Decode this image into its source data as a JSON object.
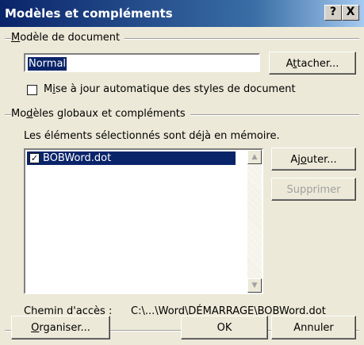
{
  "window": {
    "title": "Modèles et compléments",
    "help_label": "?",
    "close_label": "X"
  },
  "document_template": {
    "group_label": "Modèle de document",
    "value": "Normal",
    "attach_button": "Attacher...",
    "auto_update_label": "Mise à jour automatique des styles de document",
    "auto_update_checked": false
  },
  "global_templates": {
    "group_label": "Modèles globaux et compléments",
    "info_text": "Les éléments sélectionnés sont déjà en mémoire.",
    "items": [
      {
        "label": "BOBWord.dot",
        "checked": true,
        "selected": true
      }
    ],
    "add_button": "Ajouter...",
    "remove_button": "Supprimer",
    "remove_enabled": false,
    "path_label": "Chemin d'accès :",
    "path_value": "C:\\...\\Word\\DÉMARRAGE\\BOBWord.dot"
  },
  "footer": {
    "organize_button": "Organiser...",
    "ok_button": "OK",
    "cancel_button": "Annuler"
  },
  "icons": {
    "scroll_up": "scroll-up-arrow-icon",
    "scroll_down": "scroll-down-arrow-icon",
    "check": "checkmark-icon"
  }
}
